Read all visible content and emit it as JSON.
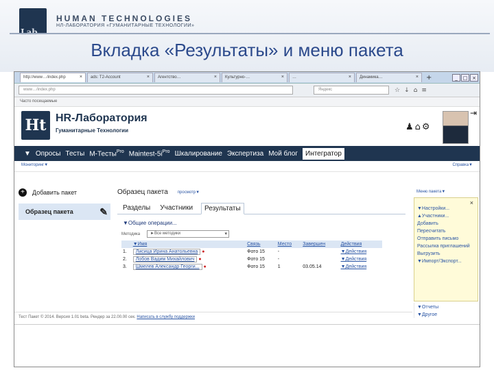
{
  "slide": {
    "brand": "HUMAN TECHNOLOGIES",
    "brand_sub": "НЛ-ЛАБОРАТОРИЯ «ГУМАНИТАРНЫЕ ТЕХНОЛОГИИ»",
    "logo_sub": "Lab",
    "title": "Вкладка «Результаты» и меню пакета"
  },
  "browser": {
    "tabs": [
      "http://www…/index.php",
      "ads: T2-Account",
      "Агентство…",
      "Культурно-…",
      "…",
      "Динамика…"
    ],
    "url": "www…/index.php",
    "search_placeholder": "Яндекс",
    "bookmarks": "Часто посещаемые"
  },
  "app": {
    "name": "HR-Лаборатория",
    "subtitle": "Гуманитарные Технологии",
    "nav": [
      "Опросы",
      "Тесты",
      "М-Тесты",
      "Maintest-5i",
      "Шкалирование",
      "Экспертиза",
      "Мой блог",
      "Интегратор"
    ],
    "nav_pro": "Pro",
    "nav_arrow": "▼",
    "main_left": "Мониторинг▼",
    "main_right": "Справка▼"
  },
  "sidebar": {
    "add_label": "Добавить пакет",
    "package_label": "Образец пакета"
  },
  "main": {
    "package_title": "Образец пакета",
    "package_mode": "просмотр▼",
    "package_menu": "Меню пакета▼",
    "tabs": [
      "Разделы",
      "Участники",
      "Результаты"
    ],
    "operations": "▼Общие операции...",
    "method_label": "Методика",
    "method_value": "►Все методики",
    "columns": [
      "▼Имя",
      "Связь",
      "Место",
      "Завершен",
      "Действия"
    ],
    "rows": [
      {
        "num": "1.",
        "name": "Лисица Ирина Анатольевна",
        "link": "Фото 15",
        "place": "-",
        "done": "",
        "action": "▼Действия"
      },
      {
        "num": "2.",
        "name": "Лобов Вадим Михайлович",
        "link": "Фото 15",
        "place": "-",
        "done": "",
        "action": "▼Действия"
      },
      {
        "num": "3.",
        "name": "Шмелев Александр Георги...",
        "link": "Фото 15",
        "place": "1",
        "done": "03.05.14",
        "action": "▼Действия"
      }
    ]
  },
  "menu": {
    "items": [
      "▼Настройки...",
      "▲Участники...",
      "Добавить",
      "Пересчитать",
      "Отправить письмо",
      "Рассылка приглашений",
      "Выгрузить",
      "▼Импорт/Экспорт...",
      "▼Отчеты",
      "▼Другое"
    ]
  },
  "footer": {
    "text": "Тест Пакет © 2014. Версия 1.01 beta. Рендер за 22.00.00 сек.",
    "link": "Написать в службу поддержки"
  }
}
